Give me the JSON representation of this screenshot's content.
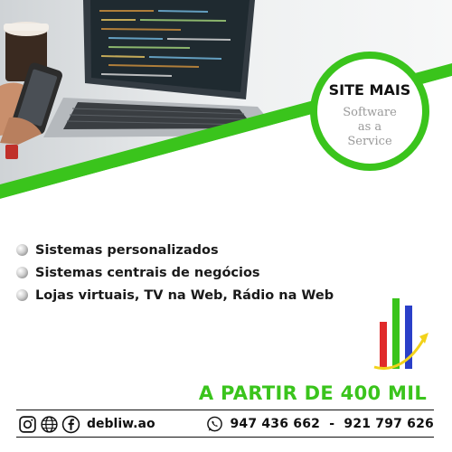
{
  "badge": {
    "title": "SITE MAIS",
    "subtitle": "Software\nas a\nService"
  },
  "features": [
    "Sistemas personalizados",
    "Sistemas centrais de negócios",
    "Lojas virtuais, TV na Web, Rádio na Web"
  ],
  "price": "A PARTIR DE 400 MIL",
  "footer": {
    "social_icons": [
      "instagram-icon",
      "web-icon",
      "facebook-icon"
    ],
    "handle": "debliw.ao",
    "phone_icon": "whatsapp-icon",
    "phones": "947 436 662  -  921 797 626"
  },
  "colors": {
    "accent_green": "#3ac41c",
    "text_dark": "#111111",
    "badge_subtitle": "#9a9a9a"
  }
}
